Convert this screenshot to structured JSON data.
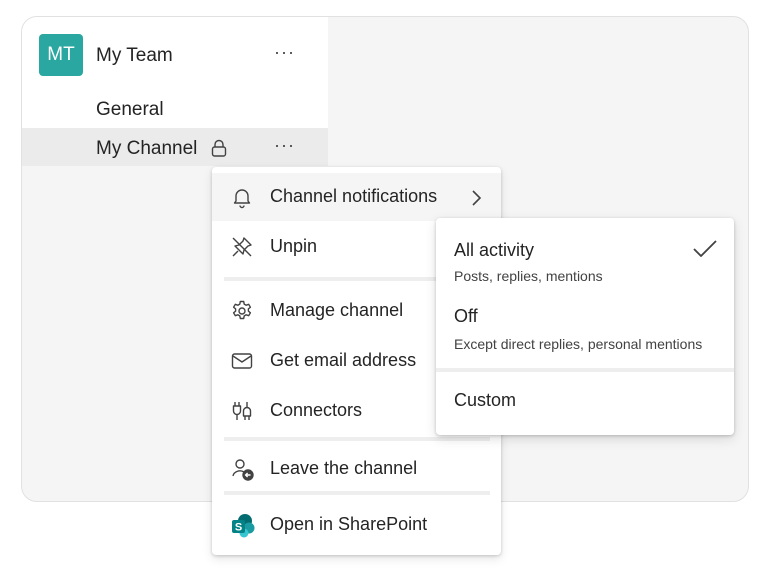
{
  "team": {
    "avatar_initials": "MT",
    "avatar_color": "#2aa7a0",
    "name": "My Team",
    "more": "···"
  },
  "channels": {
    "general": "General",
    "selected": "My Channel",
    "selected_icon": "lock-icon",
    "more": "···"
  },
  "menu": {
    "items": [
      {
        "icon": "bell-icon",
        "label": "Channel notifications",
        "has_submenu": true
      },
      {
        "icon": "unpin-icon",
        "label": "Unpin"
      },
      {
        "icon": "gear-icon",
        "label": "Manage channel"
      },
      {
        "icon": "mail-icon",
        "label": "Get email address"
      },
      {
        "icon": "connectors-icon",
        "label": "Connectors"
      },
      {
        "icon": "leave-channel-icon",
        "label": "Leave the channel"
      },
      {
        "icon": "sharepoint-icon",
        "label": "Open in SharePoint"
      }
    ]
  },
  "submenu": {
    "options": [
      {
        "title": "All activity",
        "subtitle": "Posts, replies, mentions",
        "selected": true
      },
      {
        "title": "Off",
        "subtitle": "Except direct replies, personal mentions",
        "selected": false
      },
      {
        "title": "Custom",
        "selected": false
      }
    ]
  },
  "colors": {
    "accent_teal": "#2aa7a0",
    "sharepoint_green": "#038387"
  }
}
